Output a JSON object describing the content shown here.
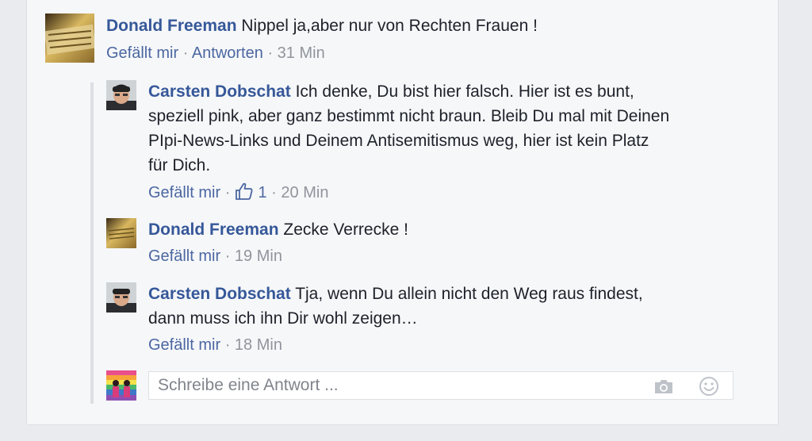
{
  "comments": [
    {
      "author": "Donald Freeman",
      "text": "Nippel ja,aber nur von Rechten Frauen !",
      "actions": {
        "like": "Gefällt mir",
        "reply": "Antworten"
      },
      "time": "31 Min",
      "separator": "·",
      "avatar_icon": "donald-avatar"
    }
  ],
  "replies": [
    {
      "author": "Carsten Dobschat",
      "text_lines": [
        "Ich denke, Du bist hier falsch. Hier ist es bunt,",
        "speziell pink, aber ganz bestimmt nicht braun. Bleib Du mal mit Deinen",
        "PIpi-News-Links und Deinem Antisemitismus weg, hier ist kein Platz",
        "für Dich."
      ],
      "like_label": "Gefällt mir",
      "like_count": "1",
      "time": "20 Min",
      "avatar_icon": "carsten-avatar"
    },
    {
      "author": "Donald Freeman",
      "text_lines": [
        "Zecke Verrecke !"
      ],
      "like_label": "Gefällt mir",
      "time": "19 Min",
      "avatar_icon": "donald-avatar"
    },
    {
      "author": "Carsten Dobschat",
      "text_lines": [
        "Tja, wenn Du allein nicht den Weg raus findest,",
        "dann muss ich ihn Dir wohl zeigen…"
      ],
      "like_label": "Gefällt mir",
      "time": "18 Min",
      "avatar_icon": "carsten-avatar"
    }
  ],
  "reply_box": {
    "placeholder": "Schreibe eine Antwort ...",
    "icons": [
      "camera-icon",
      "emoji-icon"
    ]
  },
  "colors": {
    "name": "#365899",
    "meta": "#90949c",
    "background": "#e9ebee",
    "card": "#f6f7f9"
  }
}
